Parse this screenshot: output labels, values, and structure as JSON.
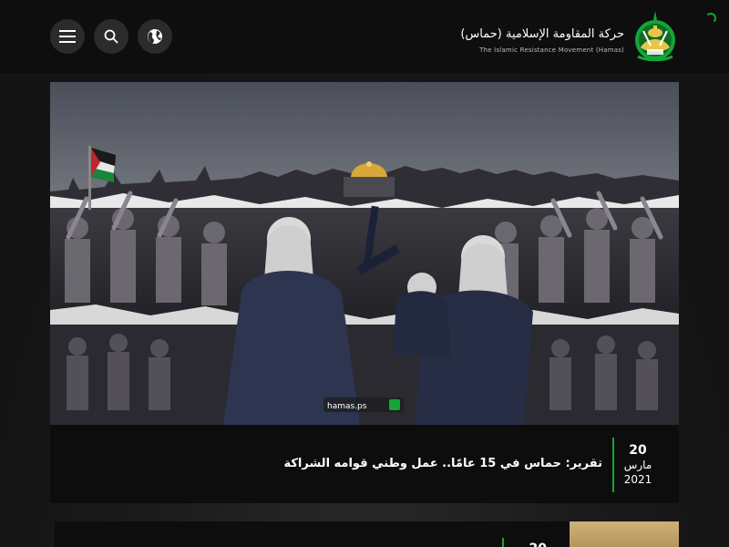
{
  "colors": {
    "accent": "#13a538",
    "header_bg": "#0e0e0e",
    "icon_button_bg": "#2b2b2b",
    "card_bg": "#0d0d0d"
  },
  "loading_progress": 0.6,
  "header": {
    "brand_name_ar": "حركة المقاومة الإسلامية (حماس)",
    "brand_name_en": "The Islamic  Resistance Movement (Hamas)",
    "buttons": [
      {
        "icon": "menu-icon"
      },
      {
        "icon": "search-icon"
      },
      {
        "icon": "globe-icon"
      }
    ]
  },
  "featured": {
    "date": {
      "day": "20",
      "month": "مارس",
      "year": "2021"
    },
    "headline": "تقرير: حماس في 15 عامًا.. عمل وطني قوامه الشراكة",
    "image_watermark": "hamas.ps"
  },
  "next_card": {
    "date_day": "20"
  }
}
